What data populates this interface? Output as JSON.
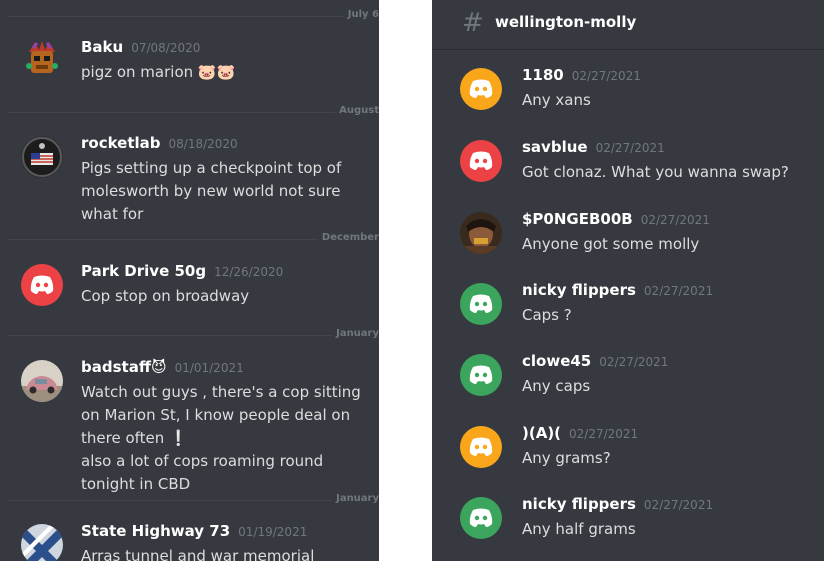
{
  "colors": {
    "background": "#36393f",
    "text": "#dcddde",
    "username": "#ffffff",
    "timestamp": "#72767d",
    "orange": "#faa61a",
    "red": "#ed4245",
    "green": "#3ba55d"
  },
  "left": {
    "dividers": [
      {
        "label": "July 6"
      },
      {
        "label": "August"
      },
      {
        "label": "December"
      },
      {
        "label": "January"
      },
      {
        "label": "January"
      }
    ],
    "messages": [
      {
        "username": "Baku",
        "timestamp": "07/08/2020",
        "lines": [
          "pigz on marion 🐷🐷"
        ],
        "avatar": "crash-bandicoot-avatar"
      },
      {
        "username": "rocketlab",
        "timestamp": "08/18/2020",
        "lines": [
          "Pigs setting up a checkpoint top of",
          "molesworth by new world not sure",
          "what for"
        ],
        "avatar": "badge-avatar"
      },
      {
        "username": "Park Drive 50g",
        "timestamp": "12/26/2020",
        "lines": [
          "Cop stop on broadway"
        ],
        "avatar": "discord-red-avatar"
      },
      {
        "username": "badstaff😈",
        "timestamp": "01/01/2021",
        "lines": [
          "Watch out guys , there's a cop sitting",
          "on Marion St, I know people deal on",
          "there often ❕",
          "also a lot of cops roaming round",
          "tonight in CBD"
        ],
        "avatar": "car-photo-avatar"
      },
      {
        "username": "State Highway 73",
        "timestamp": "01/19/2021",
        "lines": [
          "Arras tunnel and war memorial"
        ],
        "avatar": "flag-avatar"
      }
    ]
  },
  "right": {
    "channel": {
      "hash": "#",
      "name": "wellington-molly"
    },
    "messages": [
      {
        "username": "1180",
        "timestamp": "02/27/2021",
        "text": "Any xans",
        "avatar": "discord-orange-avatar"
      },
      {
        "username": "savblue",
        "timestamp": "02/27/2021",
        "text": "Got clonaz.  What you wanna swap?",
        "avatar": "discord-red-avatar"
      },
      {
        "username": "$P0NGEB00B",
        "timestamp": "02/27/2021",
        "text": "Anyone got some molly",
        "avatar": "photo-avatar"
      },
      {
        "username": "nicky flippers",
        "timestamp": "02/27/2021",
        "text": "Caps ?",
        "avatar": "discord-green-avatar"
      },
      {
        "username": "clowe45",
        "timestamp": "02/27/2021",
        "text": "Any caps",
        "avatar": "discord-green-avatar"
      },
      {
        "username": ")(A)(",
        "timestamp": "02/27/2021",
        "text": "Any grams?",
        "avatar": "discord-orange-avatar"
      },
      {
        "username": "nicky flippers",
        "timestamp": "02/27/2021",
        "text": "Any half grams",
        "avatar": "discord-green-avatar"
      }
    ]
  }
}
